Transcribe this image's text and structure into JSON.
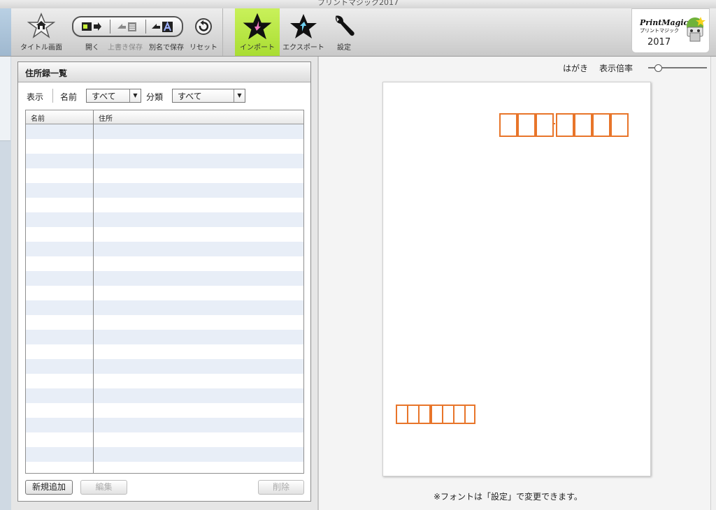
{
  "app": {
    "window_title": "プリントマジック2017"
  },
  "toolbar": {
    "title_screen": "タイトル画面",
    "open": "開く",
    "overwrite_save": "上書き保存",
    "save_as": "別名で保存",
    "reset": "リセット",
    "import": "インポート",
    "export": "エクスポート",
    "settings": "設定"
  },
  "logo": {
    "line1": "PrintMagic",
    "line2": "プリントマジック",
    "year": "2017"
  },
  "address_panel": {
    "title": "住所録一覧",
    "display_label": "表示",
    "name_label": "名前",
    "name_filter": "すべて",
    "category_label": "分類",
    "category_filter": "すべて",
    "columns": [
      "名前",
      "住所"
    ],
    "add_button": "新規追加",
    "edit_button": "編集",
    "delete_button": "削除"
  },
  "preview": {
    "card_type": "はがき",
    "zoom_label": "表示倍率",
    "zoom_level": 0.17,
    "note": "※フォントは「設定」で変更できます。"
  },
  "colors": {
    "accent_import": "#b5e63f",
    "postal_box": "#e8752a",
    "row_alt": "#e8eef7"
  }
}
